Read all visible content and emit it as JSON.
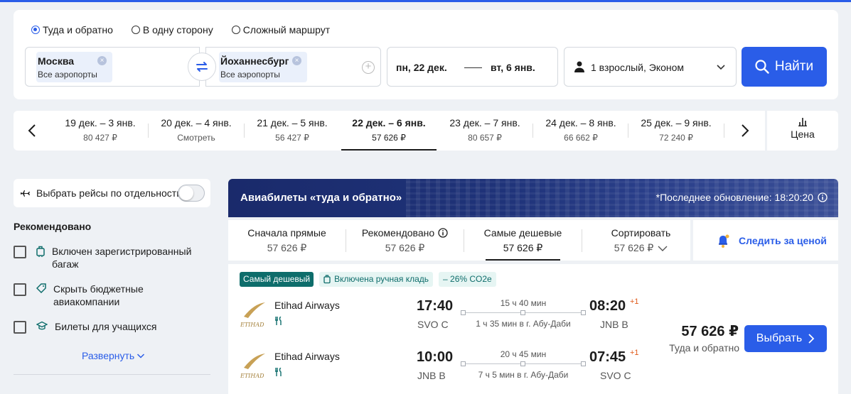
{
  "trip_types": [
    {
      "label": "Туда и обратно",
      "checked": true
    },
    {
      "label": "В одну сторону",
      "checked": false
    },
    {
      "label": "Сложный маршрут",
      "checked": false
    }
  ],
  "search": {
    "from_city": "Москва",
    "from_sub": "Все аэропорты",
    "to_city": "Йоханнесбург",
    "to_sub": "Все аэропорты",
    "date_out": "пн, 22 дек.",
    "date_ret": "вт, 6 янв.",
    "passengers": "1 взрослый, Эконом",
    "button": "Найти"
  },
  "date_strip": [
    {
      "range": "19 дек. – 3 янв.",
      "price": "80 427 ₽",
      "active": false
    },
    {
      "range": "20 дек. – 4 янв.",
      "price": "Смотреть",
      "active": false
    },
    {
      "range": "21 дек. – 5 янв.",
      "price": "56 427 ₽",
      "active": false
    },
    {
      "range": "22 дек. – 6 янв.",
      "price": "57 626 ₽",
      "active": true
    },
    {
      "range": "23 дек. – 7 янв.",
      "price": "80 657 ₽",
      "active": false
    },
    {
      "range": "24 дек. – 8 янв.",
      "price": "66 662 ₽",
      "active": false
    },
    {
      "range": "25 дек. – 9 янв.",
      "price": "72 240 ₽",
      "active": false
    }
  ],
  "price_button": "Цена",
  "sidebar": {
    "separate_flights": "Выбрать рейсы по отдельности",
    "recommended_title": "Рекомендовано",
    "filters": [
      {
        "label": "Включен зарегистрированный багаж",
        "icon": "luggage-icon"
      },
      {
        "label": "Скрыть бюджетные авиакомпании",
        "icon": "tag-icon"
      },
      {
        "label": "Билеты для учащихся",
        "icon": "graduation-cap-icon"
      }
    ],
    "expand": "Развернуть"
  },
  "banner": {
    "title": "Авиабилеты «туда и обратно»",
    "updated": "*Последнее обновление: 18:20:20"
  },
  "sort": [
    {
      "label": "Сначала прямые",
      "value": "57 626 ₽"
    },
    {
      "label": "Рекомендовано",
      "value": "57 626 ₽"
    },
    {
      "label": "Самые дешевые",
      "value": "57 626 ₽"
    },
    {
      "label": "Сортировать",
      "value": "57 626 ₽"
    }
  ],
  "watch_price": "Следить за ценой",
  "ticket": {
    "badge_cheapest": "Самый дешевый",
    "badge_luggage": "Включена ручная кладь",
    "badge_co2": "– 26% CO2e",
    "legs": [
      {
        "airline": "Etihad Airways",
        "dep_time": "17:40",
        "dep_code": "SVO C",
        "duration": "15 ч 40 мин",
        "stop": "1 ч 35 мин в г. Абу-Даби",
        "arr_time": "08:20",
        "arr_code": "JNB B",
        "day_shift": "+1"
      },
      {
        "airline": "Etihad Airways",
        "dep_time": "10:00",
        "dep_code": "JNB B",
        "duration": "20 ч 45 мин",
        "stop": "7 ч 5 мин в г. Абу-Даби",
        "arr_time": "07:45",
        "arr_code": "SVO C",
        "day_shift": "+1"
      }
    ],
    "logo_text": "ETIHAD",
    "price": "57 626 ₽",
    "price_sub": "Туда и обратно",
    "choose": "Выбрать"
  },
  "colors": {
    "accent": "#2a5de8",
    "teal": "#0e6d6b",
    "banner": "#1f3379",
    "day_shift": "#e05a1a"
  }
}
